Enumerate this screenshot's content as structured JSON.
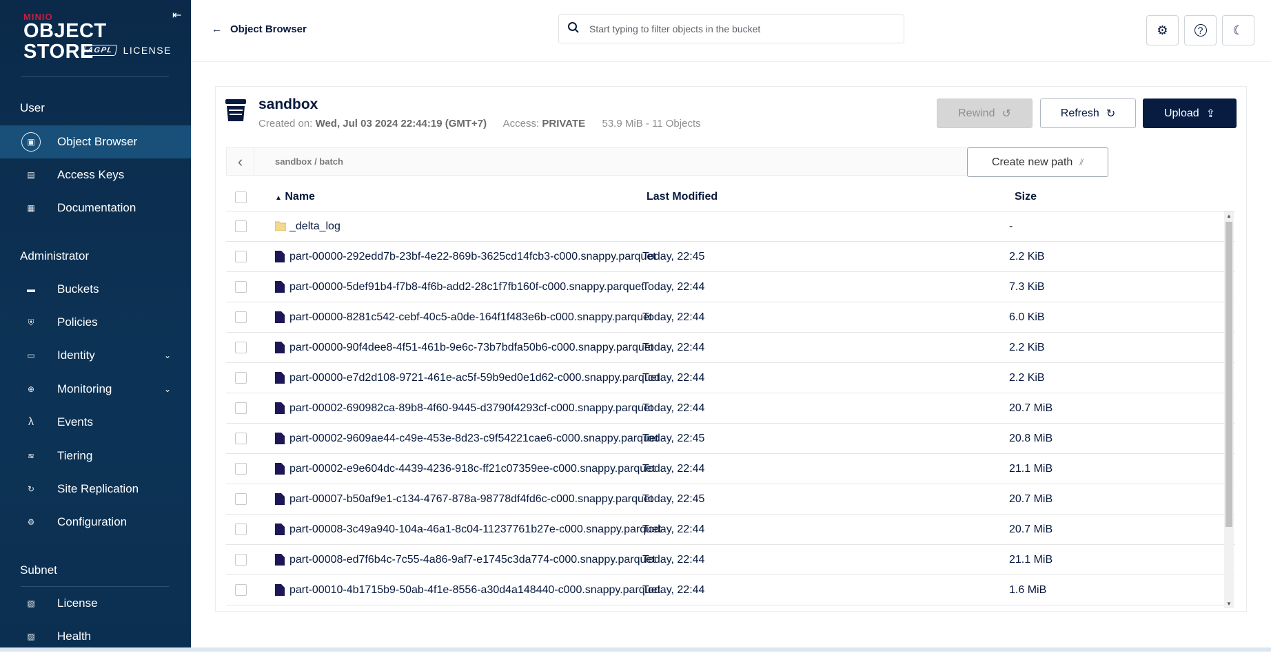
{
  "sidebar": {
    "logo": {
      "brand": "MINIO",
      "product": "OBJECT STORE",
      "license_badge": "AGPL",
      "license_text": "LICENSE"
    },
    "sections": [
      {
        "title": "User",
        "items": [
          {
            "label": "Object Browser",
            "icon": "object-browser-icon",
            "active": true
          },
          {
            "label": "Access Keys",
            "icon": "access-keys-icon"
          },
          {
            "label": "Documentation",
            "icon": "documentation-icon"
          }
        ]
      },
      {
        "title": "Administrator",
        "items": [
          {
            "label": "Buckets",
            "icon": "buckets-icon"
          },
          {
            "label": "Policies",
            "icon": "policies-icon"
          },
          {
            "label": "Identity",
            "icon": "identity-icon",
            "expandable": true
          },
          {
            "label": "Monitoring",
            "icon": "monitoring-icon",
            "expandable": true
          },
          {
            "label": "Events",
            "icon": "lambda-icon"
          },
          {
            "label": "Tiering",
            "icon": "tiering-icon"
          },
          {
            "label": "Site Replication",
            "icon": "site-replication-icon"
          },
          {
            "label": "Configuration",
            "icon": "gear-icon"
          }
        ]
      },
      {
        "title": "Subnet",
        "items": [
          {
            "label": "License",
            "icon": "license-icon"
          },
          {
            "label": "Health",
            "icon": "health-icon"
          }
        ]
      }
    ]
  },
  "header": {
    "back_label": "Object Browser",
    "search_placeholder": "Start typing to filter objects in the bucket"
  },
  "bucket": {
    "name": "sandbox",
    "created_label": "Created on:",
    "created_value": "Wed, Jul 03 2024 22:44:19 (GMT+7)",
    "access_label": "Access:",
    "access_value": "PRIVATE",
    "usage": "53.9 MiB - 11 Objects",
    "rewind_label": "Rewind",
    "refresh_label": "Refresh",
    "upload_label": "Upload"
  },
  "path": {
    "crumb": "sandbox / batch",
    "create_new_path_label": "Create new path"
  },
  "table": {
    "columns": {
      "name": "Name",
      "modified": "Last Modified",
      "size": "Size"
    },
    "rows": [
      {
        "name": "_delta_log",
        "type": "folder",
        "modified": "",
        "size": "-"
      },
      {
        "name": "part-00000-292edd7b-23bf-4e22-869b-3625cd14fcb3-c000.snappy.parquet",
        "type": "file",
        "modified": "Today, 22:45",
        "size": "2.2 KiB"
      },
      {
        "name": "part-00000-5def91b4-f7b8-4f6b-add2-28c1f7fb160f-c000.snappy.parquet",
        "type": "file",
        "modified": "Today, 22:44",
        "size": "7.3 KiB"
      },
      {
        "name": "part-00000-8281c542-cebf-40c5-a0de-164f1f483e6b-c000.snappy.parquet",
        "type": "file",
        "modified": "Today, 22:44",
        "size": "6.0 KiB"
      },
      {
        "name": "part-00000-90f4dee8-4f51-461b-9e6c-73b7bdfa50b6-c000.snappy.parquet",
        "type": "file",
        "modified": "Today, 22:44",
        "size": "2.2 KiB"
      },
      {
        "name": "part-00000-e7d2d108-9721-461e-ac5f-59b9ed0e1d62-c000.snappy.parquet",
        "type": "file",
        "modified": "Today, 22:44",
        "size": "2.2 KiB"
      },
      {
        "name": "part-00002-690982ca-89b8-4f60-9445-d3790f4293cf-c000.snappy.parquet",
        "type": "file",
        "modified": "Today, 22:44",
        "size": "20.7 MiB"
      },
      {
        "name": "part-00002-9609ae44-c49e-453e-8d23-c9f54221cae6-c000.snappy.parquet",
        "type": "file",
        "modified": "Today, 22:45",
        "size": "20.8 MiB"
      },
      {
        "name": "part-00002-e9e604dc-4439-4236-918c-ff21c07359ee-c000.snappy.parquet",
        "type": "file",
        "modified": "Today, 22:44",
        "size": "21.1 MiB"
      },
      {
        "name": "part-00007-b50af9e1-c134-4767-878a-98778df4fd6c-c000.snappy.parquet",
        "type": "file",
        "modified": "Today, 22:45",
        "size": "20.7 MiB"
      },
      {
        "name": "part-00008-3c49a940-104a-46a1-8c04-11237761b27e-c000.snappy.parquet",
        "type": "file",
        "modified": "Today, 22:44",
        "size": "20.7 MiB"
      },
      {
        "name": "part-00008-ed7f6b4c-7c55-4a86-9af7-e1745c3da774-c000.snappy.parquet",
        "type": "file",
        "modified": "Today, 22:44",
        "size": "21.1 MiB"
      },
      {
        "name": "part-00010-4b1715b9-50ab-4f1e-8556-a30d4a148440-c000.snappy.parquet",
        "type": "file",
        "modified": "Today, 22:44",
        "size": "1.6 MiB"
      }
    ]
  }
}
